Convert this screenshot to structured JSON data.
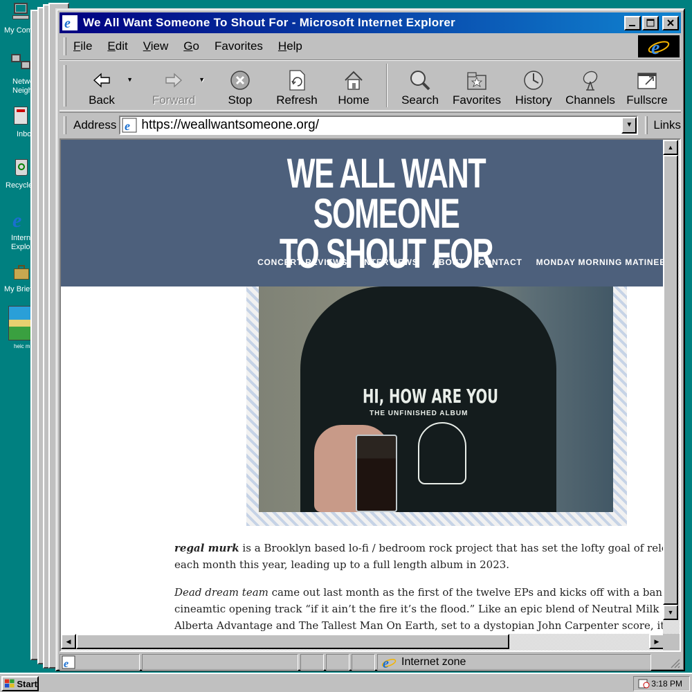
{
  "desktop": {
    "icons": [
      {
        "label": "My Comp"
      },
      {
        "label": "Netwo Neighbo"
      },
      {
        "label": "Inbo"
      },
      {
        "label": "Recycle"
      },
      {
        "label": "Intern Explo"
      },
      {
        "label": "My Brief"
      },
      {
        "label": "heic me"
      }
    ]
  },
  "window": {
    "title": "We All Want Someone To Shout For - Microsoft Internet Explorer",
    "minimize_icon": "minimize-icon",
    "maximize_icon": "maximize-icon",
    "close_icon": "close-icon"
  },
  "menu": [
    {
      "key": "F",
      "rest": "ile"
    },
    {
      "key": "E",
      "rest": "dit"
    },
    {
      "key": "V",
      "rest": "iew"
    },
    {
      "key": "G",
      "rest": "o"
    },
    {
      "key": "Fav",
      "rest": "orites",
      "prefix": ""
    },
    {
      "key": "H",
      "rest": "elp"
    }
  ],
  "toolbar": {
    "back": "Back",
    "forward": "Forward",
    "stop": "Stop",
    "refresh": "Refresh",
    "home": "Home",
    "search": "Search",
    "favorites": "Favorites",
    "history": "History",
    "channels": "Channels",
    "fullscreen": "Fullscre"
  },
  "address": {
    "label": "Address",
    "url": "https://weallwantsomeone.org/",
    "links": "Links"
  },
  "site": {
    "title_line1": "WE ALL WANT SOMEONE",
    "title_line2": "TO SHOUT FOR",
    "nav": [
      "CONCERT REVIEWS",
      "INTERVIEWS",
      "ABOUT",
      "CONTACT",
      "MONDAY MORNING MATINEE"
    ],
    "photo": {
      "shirt_text": "HI, HOW ARE YOU",
      "shirt_sub": "THE UNFINISHED ALBUM"
    }
  },
  "article": {
    "p1_bold": "regal murk",
    "p1_line1": " is a Brooklyn based lo-fi / bedroom rock project that has set the lofty goal of releasing an",
    "p1_line2": "each month this year, leading up to a full length album in 2023.",
    "p2_italic": "Dead dream team",
    "p2_line1": " came out last month as the first of the twelve EPs and kicks off with a bang with the",
    "p2_line2": "cineamtic opening track “if it ain’t the fire it’s the flood.” Like an epic blend of Neutral Milk Hotel, Ru",
    "p2_line3": "Alberta Advantage and The Tallest Man On Earth, set to a dystopian John Carpenter score, it’s a blen"
  },
  "status": {
    "zone": "Internet zone"
  },
  "taskbar": {
    "start": "Start",
    "clock": "3:18 PM"
  }
}
